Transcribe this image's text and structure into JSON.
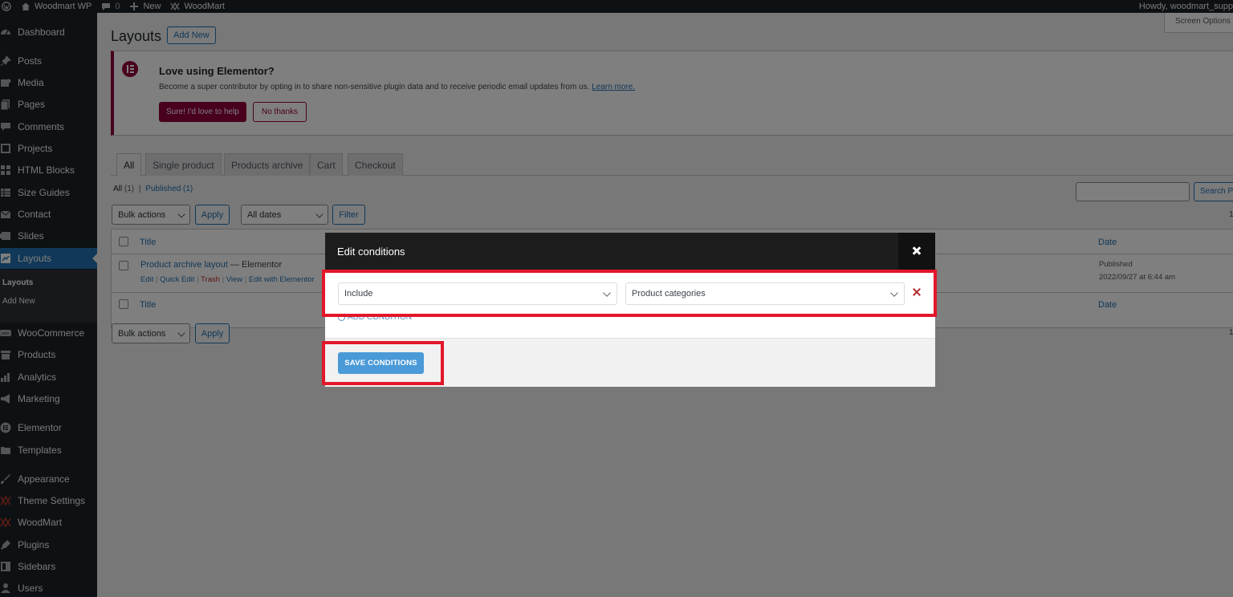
{
  "adminbar": {
    "site_name": "Woodmart WP",
    "comments_count": "0",
    "new_label": "New",
    "theme_label": "WoodMart",
    "howdy": "Howdy, woodmart_supp"
  },
  "sidebar": {
    "items": [
      {
        "label": "Dashboard",
        "icon": "dashboard-icon"
      },
      {
        "label": "Posts",
        "icon": "pin-icon"
      },
      {
        "label": "Media",
        "icon": "media-icon"
      },
      {
        "label": "Pages",
        "icon": "pages-icon"
      },
      {
        "label": "Comments",
        "icon": "comment-icon"
      },
      {
        "label": "Projects",
        "icon": "projects-icon"
      },
      {
        "label": "HTML Blocks",
        "icon": "blocks-icon"
      },
      {
        "label": "Size Guides",
        "icon": "table-icon"
      },
      {
        "label": "Contact",
        "icon": "mail-icon"
      },
      {
        "label": "Slides",
        "icon": "slides-icon"
      },
      {
        "label": "Layouts",
        "icon": "layouts-icon"
      },
      {
        "label": "WooCommerce",
        "icon": "woo-icon"
      },
      {
        "label": "Products",
        "icon": "archive-icon"
      },
      {
        "label": "Analytics",
        "icon": "chart-icon"
      },
      {
        "label": "Marketing",
        "icon": "megaphone-icon"
      },
      {
        "label": "Elementor",
        "icon": "elementor-icon"
      },
      {
        "label": "Templates",
        "icon": "folder-icon"
      },
      {
        "label": "Appearance",
        "icon": "brush-icon"
      },
      {
        "label": "Theme Settings",
        "icon": "woodmart-icon"
      },
      {
        "label": "WoodMart",
        "icon": "woodmart-icon"
      },
      {
        "label": "Plugins",
        "icon": "plugin-icon"
      },
      {
        "label": "Sidebars",
        "icon": "sidebars-icon"
      },
      {
        "label": "Users",
        "icon": "users-icon"
      }
    ],
    "submenu": [
      "Layouts",
      "Add New"
    ]
  },
  "page": {
    "title": "Layouts",
    "add_new": "Add New",
    "screen_options": "Screen Options"
  },
  "notice": {
    "title": "Love using Elementor?",
    "desc": "Become a super contributor by opting in to share non-sensitive plugin data and to receive periodic email updates from us.",
    "learn_more": "Learn more.",
    "accept": "Sure! I'd love to help",
    "decline": "No thanks"
  },
  "tabs": [
    "All",
    "Single product",
    "Products archive",
    "Cart",
    "Checkout"
  ],
  "subsubsub": {
    "all": "All",
    "all_count": "(1)",
    "sep": "|",
    "published": "Published",
    "published_count": "(1)"
  },
  "search": {
    "button": "Search Po"
  },
  "filters": {
    "bulk_actions": "Bulk actions",
    "apply": "Apply",
    "all_dates": "All dates",
    "filter": "Filter",
    "items": "1"
  },
  "table": {
    "col_title": "Title",
    "col_date": "Date",
    "row": {
      "title": "Product archive layout",
      "sep": " — ",
      "state": "Elementor",
      "actions": [
        "Edit",
        "Quick Edit",
        "Trash",
        "View",
        "Edit with Elementor"
      ],
      "status": "Published",
      "date": "2022/09/27 at 6:44 am"
    }
  },
  "modal": {
    "title": "Edit conditions",
    "condition_type": "Include",
    "condition_target": "Product categories",
    "add_condition": "ADD CONDITION",
    "save": "SAVE CONDITIONS"
  },
  "colors": {
    "admin_dark": "#1d2327",
    "accent_blue": "#2271b1",
    "elementor_red": "#93003c",
    "highlight_red": "#e3162a",
    "save_blue": "#4a9ad8"
  }
}
